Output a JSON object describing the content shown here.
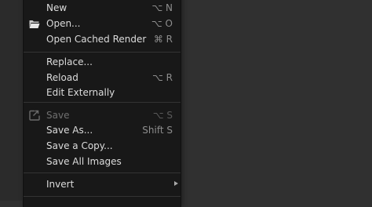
{
  "menu": {
    "items": [
      {
        "label": "New",
        "shortcut": "⌥ N"
      },
      {
        "label": "Open...",
        "shortcut": "⌥ O",
        "icon": "folder-open-icon"
      },
      {
        "label": "Open Cached Render",
        "shortcut": "⌘ R"
      },
      {
        "label": "Replace...",
        "shortcut": ""
      },
      {
        "label": "Reload",
        "shortcut": "⌥ R"
      },
      {
        "label": "Edit Externally",
        "shortcut": ""
      },
      {
        "label": "Save",
        "shortcut": "⌥ S",
        "icon": "save-file-icon",
        "disabled": true
      },
      {
        "label": "Save As...",
        "shortcut": "Shift S"
      },
      {
        "label": "Save a Copy...",
        "shortcut": ""
      },
      {
        "label": "Save All Images",
        "shortcut": ""
      },
      {
        "label": "Invert",
        "shortcut": "",
        "submenu": true
      }
    ]
  },
  "colors": {
    "menu_bg": "#181818",
    "text": "#dcdcdc",
    "shortcut": "#8e8e8e",
    "disabled_text": "#707070",
    "separator": "#333333",
    "editor_bg": "#303030"
  }
}
